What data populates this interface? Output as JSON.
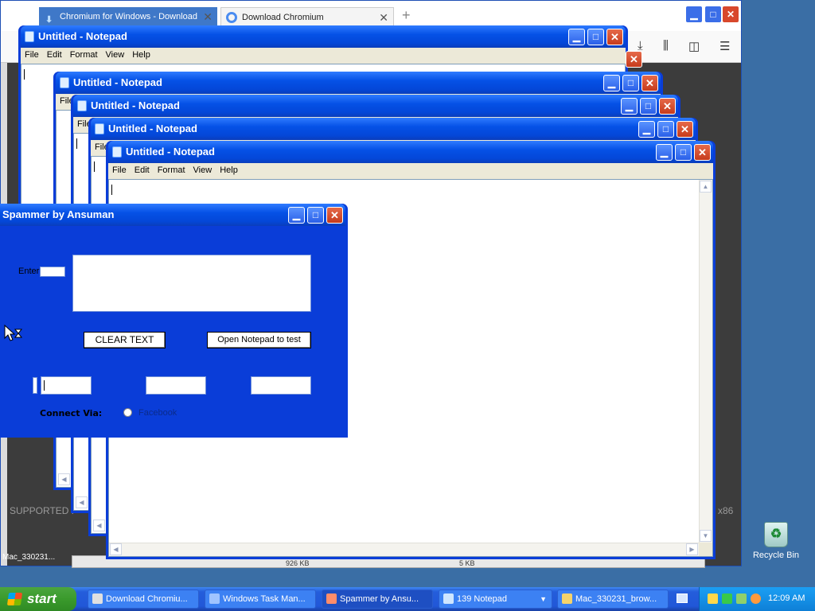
{
  "browser": {
    "tabs": [
      {
        "label": "Chromium for Windows - Download"
      },
      {
        "label": "Download Chromium"
      }
    ],
    "new_tab": "+",
    "page_left_text": "SUPPORTED P",
    "page_right_text": "x86",
    "downloads": [
      "926 KB",
      "5 KB"
    ],
    "download_left": "Mac_330231..."
  },
  "notepad": {
    "title": "Untitled - Notepad",
    "menu": [
      "File",
      "Edit",
      "Format",
      "View",
      "Help"
    ],
    "partial_menu": "File"
  },
  "spammer": {
    "title": "Spammer by Ansuman",
    "enter_label": "Enter",
    "clear_button": "CLEAR TEXT",
    "open_notepad_button": "Open Notepad to test",
    "connect_label": "Connect Via:",
    "facebook_label": "Facebook"
  },
  "desktop": {
    "recycle_bin": "Recycle Bin"
  },
  "taskbar": {
    "start": "start",
    "tasks": [
      {
        "label": "Download Chromiu...",
        "color": "#e0e0e0"
      },
      {
        "label": "Windows Task Man...",
        "color": "#a0c4ff"
      },
      {
        "label": "Spammer by Ansu...",
        "color": "#ff8c6a"
      },
      {
        "label": "139 Notepad",
        "color": "#cfe6ff"
      },
      {
        "label": "Mac_330231_brow...",
        "color": "#f5d36b"
      }
    ],
    "clock": "12:09 AM"
  }
}
